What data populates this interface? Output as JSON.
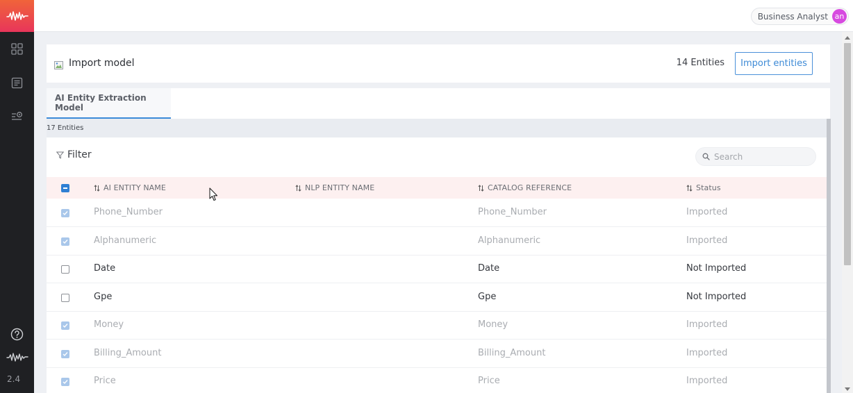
{
  "app": {
    "version": "2.4",
    "user": {
      "name": "Business Analyst",
      "initials": "an"
    }
  },
  "header": {
    "title": "Import model",
    "entity_count": "14 Entities",
    "import_button": "Import entities"
  },
  "tabs": [
    {
      "label": "AI Entity Extraction Model",
      "active": true
    }
  ],
  "summary": {
    "count": "17 Entities"
  },
  "filter": {
    "label": "Filter"
  },
  "search": {
    "placeholder": "Search"
  },
  "table": {
    "columns": [
      "AI ENTITY NAME",
      "NLP ENTITY NAME",
      "CATALOG REFERENCE",
      "Status"
    ],
    "rows": [
      {
        "ai_name": "Phone_Number",
        "nlp_name": "",
        "catalog": "Phone_Number",
        "status": "Imported",
        "checked": true
      },
      {
        "ai_name": "Alphanumeric",
        "nlp_name": "",
        "catalog": "Alphanumeric",
        "status": "Imported",
        "checked": true
      },
      {
        "ai_name": "Date",
        "nlp_name": "",
        "catalog": "Date",
        "status": "Not Imported",
        "checked": false
      },
      {
        "ai_name": "Gpe",
        "nlp_name": "",
        "catalog": "Gpe",
        "status": "Not Imported",
        "checked": false
      },
      {
        "ai_name": "Money",
        "nlp_name": "",
        "catalog": "Money",
        "status": "Imported",
        "checked": true
      },
      {
        "ai_name": "Billing_Amount",
        "nlp_name": "",
        "catalog": "Billing_Amount",
        "status": "Imported",
        "checked": true
      },
      {
        "ai_name": "Price",
        "nlp_name": "",
        "catalog": "Price",
        "status": "Imported",
        "checked": true
      }
    ]
  },
  "colors": {
    "accent": "#3b8ad8",
    "sidebar": "#1f2023",
    "logo_gradient_top": "#f0643a",
    "logo_gradient_bottom": "#e8365a",
    "avatar": "#d74ae0",
    "header_row": "#fdf0f0"
  },
  "icons": {
    "logo": "waveform-logo-icon",
    "nav": [
      "dashboard-grid-icon",
      "document-list-icon",
      "settings-list-icon"
    ],
    "help": "help-circle-icon",
    "brand_footer": "waveform-icon",
    "filter": "filter-funnel-icon",
    "search": "search-icon",
    "sort": "sort-arrows-icon"
  }
}
